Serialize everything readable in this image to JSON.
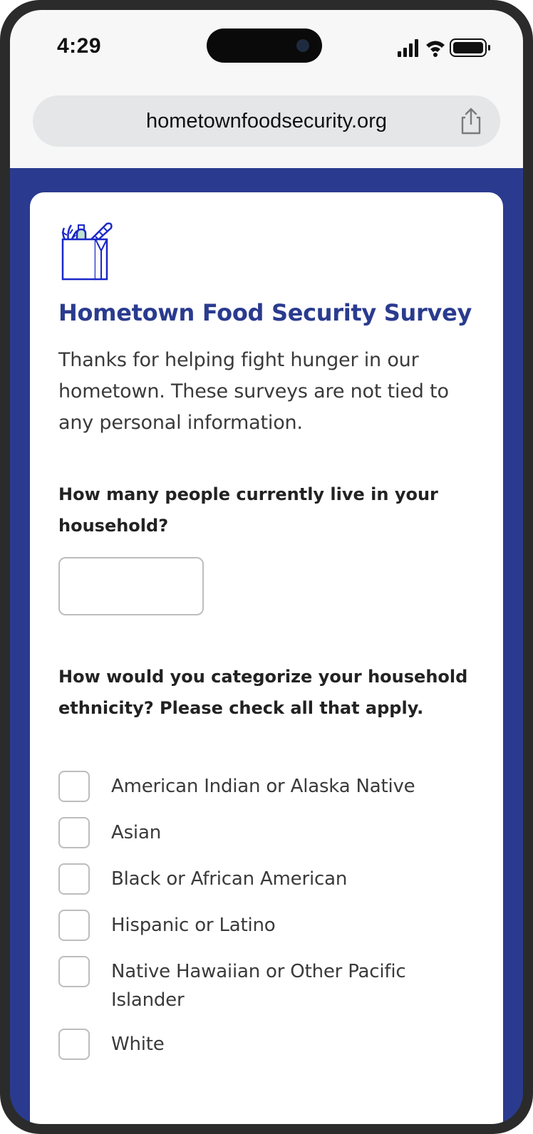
{
  "status_bar": {
    "time": "4:29"
  },
  "browser": {
    "url": "hometownfoodsecurity.org",
    "share_icon": "share-icon"
  },
  "survey": {
    "logo_icon": "grocery-bag-icon",
    "title": "Hometown Food Security Survey",
    "intro": "Thanks for helping fight hunger in our hometown. These surveys are not tied to any personal information.",
    "question_household": {
      "label": "How many people currently live in your household?",
      "value": "",
      "placeholder": ""
    },
    "question_ethnicity": {
      "label": "How would you categorize your household ethnicity? Please check all that apply.",
      "options": [
        {
          "label": "American Indian or Alaska Native",
          "checked": false
        },
        {
          "label": "Asian",
          "checked": false
        },
        {
          "label": "Black or African American",
          "checked": false
        },
        {
          "label": "Hispanic or Latino",
          "checked": false
        },
        {
          "label": "Native Hawaiian or Other Pacific Islander",
          "checked": false
        },
        {
          "label": "White",
          "checked": false
        }
      ]
    }
  },
  "colors": {
    "brand": "#2a3b8f",
    "page_background": "#2a3b8f",
    "card_background": "#ffffff",
    "border": "#bdbdbd"
  }
}
